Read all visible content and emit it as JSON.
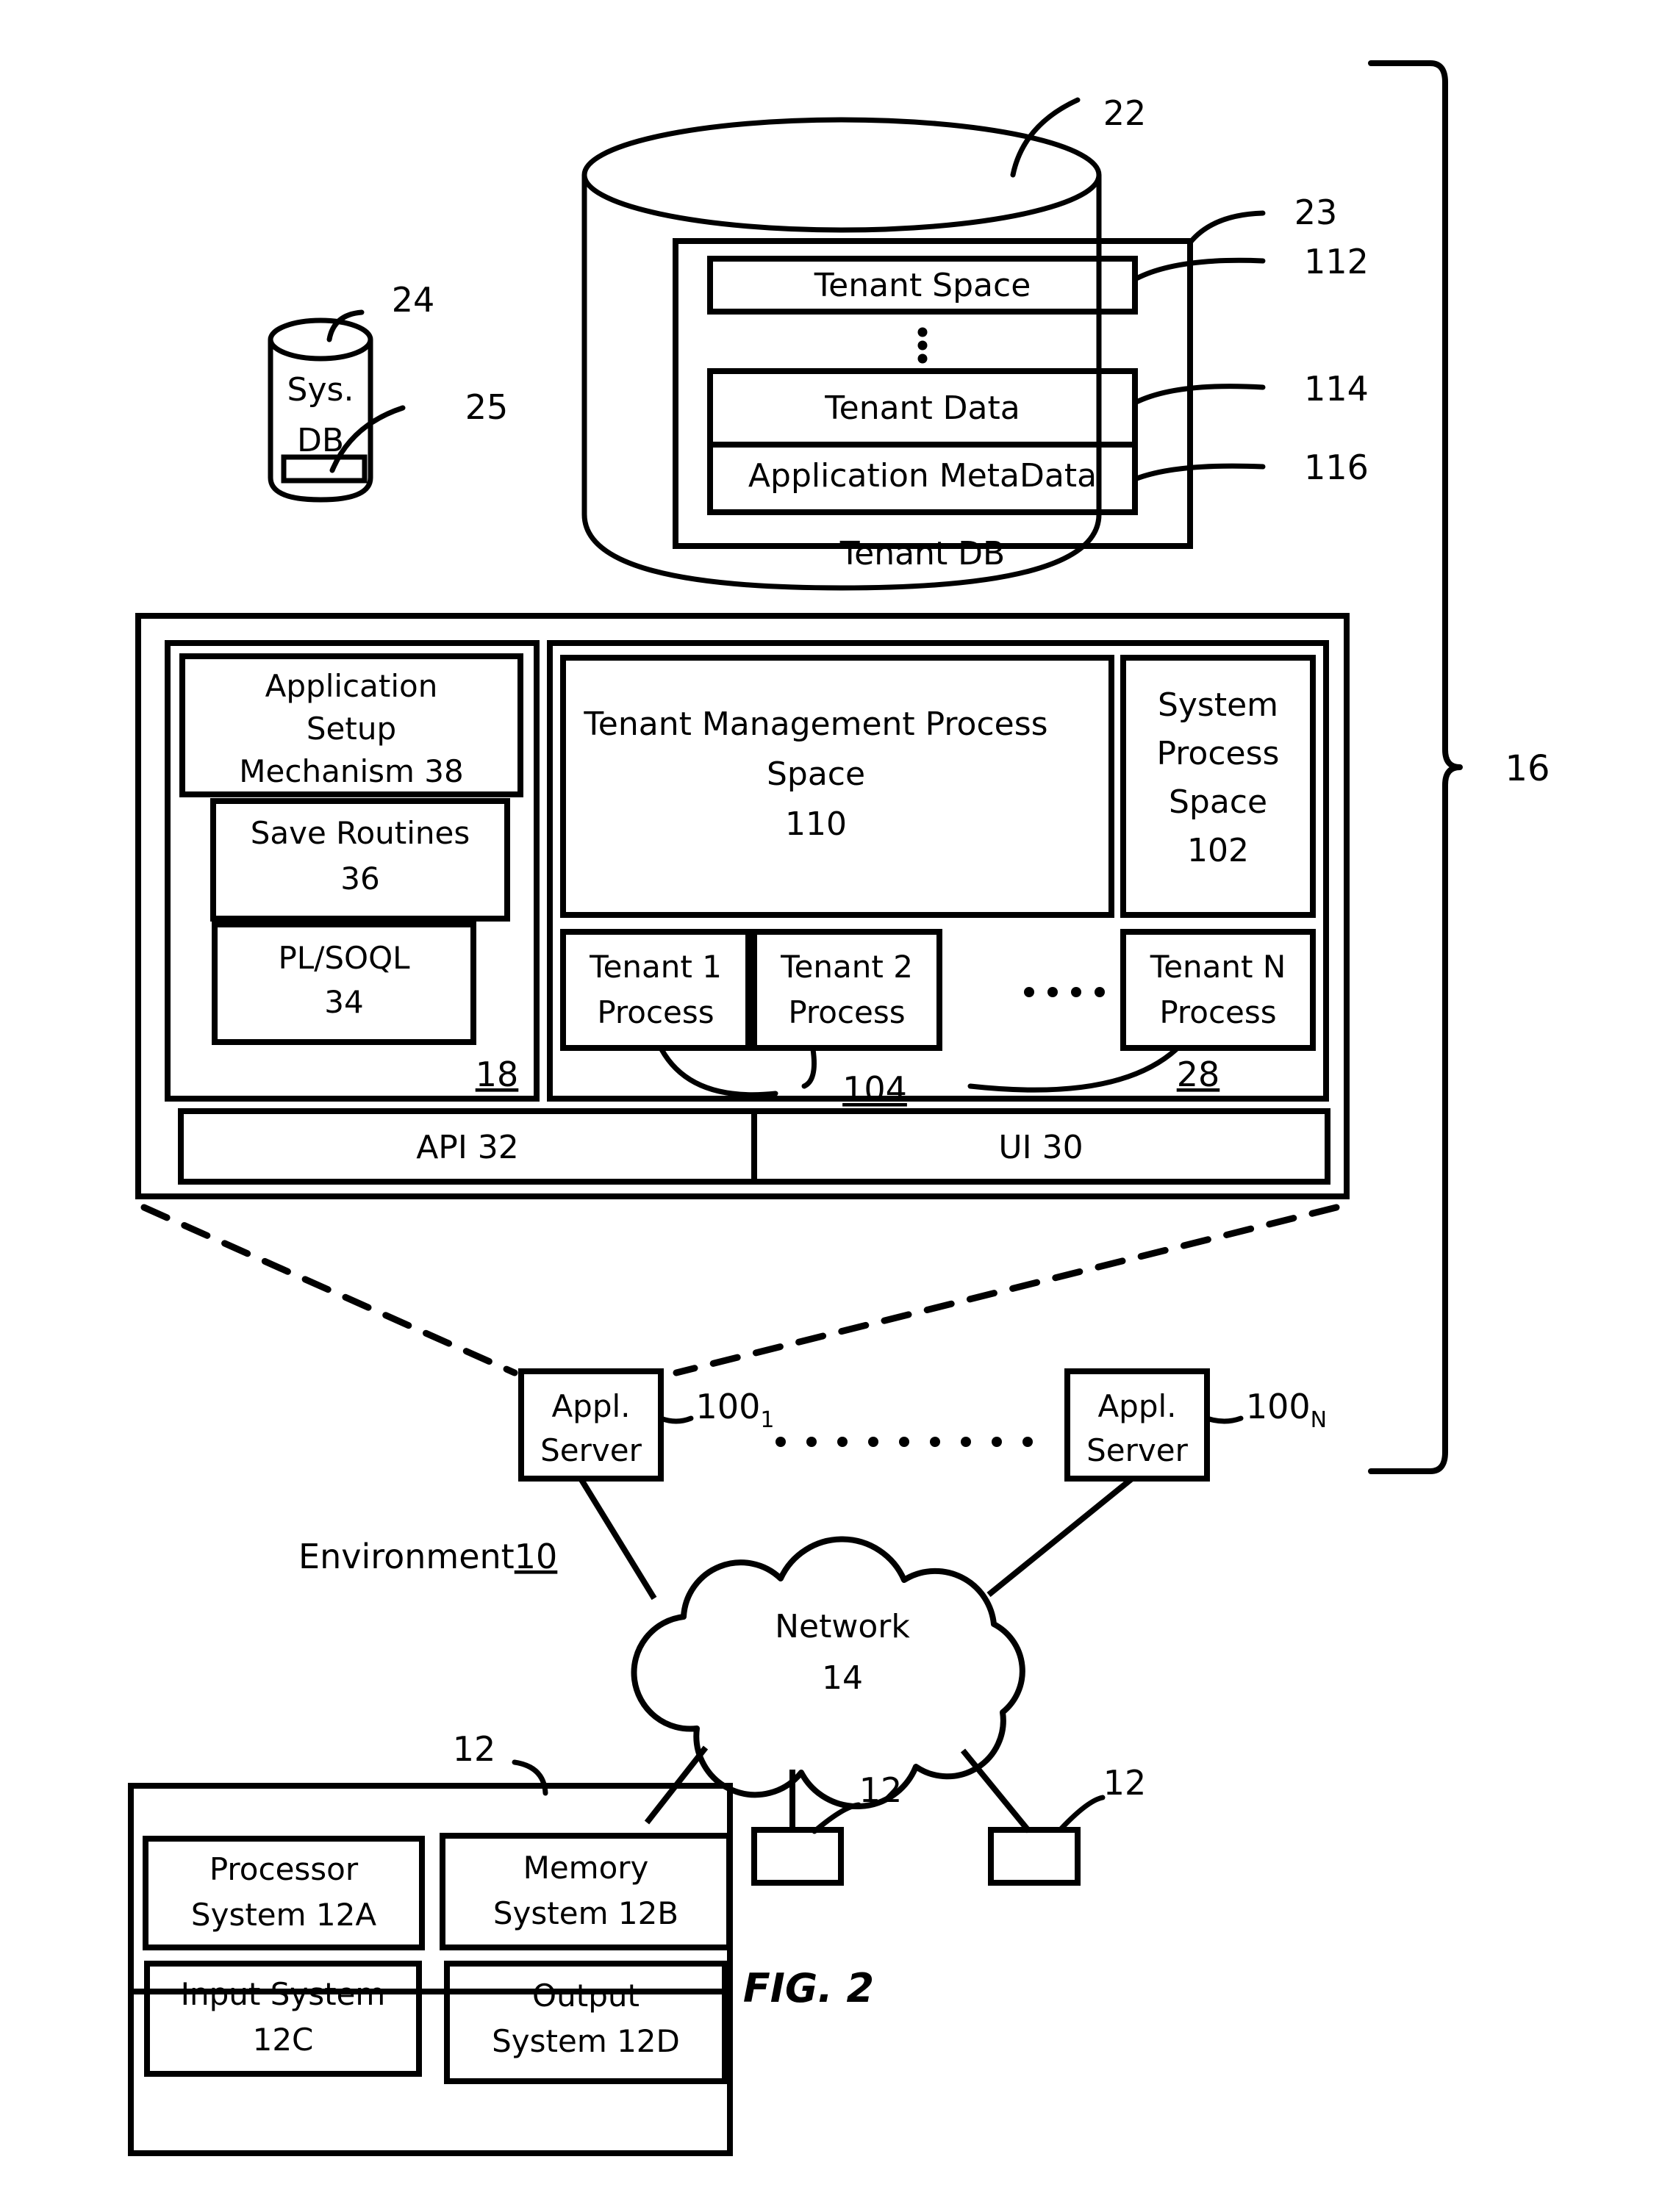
{
  "figure": {
    "caption": "FIG. 2",
    "domain_note": "patent-block-diagram"
  },
  "system_db": {
    "line1": "Sys.",
    "line2": "DB",
    "ref_cylinder": "24",
    "ref_inner": "25"
  },
  "tenant_db": {
    "caption": "Tenant DB",
    "ref_cylinder": "22",
    "ref_outer_box": "23",
    "blocks": [
      {
        "label": "Tenant Space",
        "ref": "112"
      },
      {
        "label": "Tenant Data",
        "ref": "114"
      },
      {
        "label": "Application MetaData",
        "ref": "116"
      }
    ],
    "ellipsis": "⋮"
  },
  "system": {
    "ref_bracket": "16",
    "app_platform": {
      "ref": "18",
      "blocks": [
        {
          "label": "Application Setup Mechanism 38",
          "lines": [
            "Application",
            "Setup",
            "Mechanism 38"
          ]
        },
        {
          "label": "Save Routines 36",
          "lines": [
            "Save Routines",
            "36"
          ]
        },
        {
          "label": "PL/SOQL 34",
          "lines": [
            "PL/SOQL",
            "34"
          ]
        }
      ]
    },
    "process_space": {
      "ref": "28",
      "ref_tenant_process": "104",
      "tenant_mgmt": {
        "lines": [
          "Tenant Management Process",
          "Space",
          "110"
        ],
        "ref": "110"
      },
      "system_process": {
        "lines": [
          "System",
          "Process",
          "Space",
          "102"
        ],
        "ref": "102"
      },
      "tenant_processes": [
        {
          "lines": [
            "Tenant 1",
            "Process"
          ]
        },
        {
          "lines": [
            "Tenant 2",
            "Process"
          ]
        },
        {
          "lines": [
            "Tenant N",
            "Process"
          ]
        }
      ],
      "process_ellipsis": "․ ․ ․ ․"
    },
    "bottom_bar": [
      {
        "label": "API 32"
      },
      {
        "label": "UI 30"
      }
    ]
  },
  "app_servers": [
    {
      "lines": [
        "Appl.",
        "Server"
      ],
      "ref_base": "100",
      "ref_sub": "1"
    },
    {
      "lines": [
        "Appl.",
        "Server"
      ],
      "ref_base": "100",
      "ref_sub": "N"
    }
  ],
  "app_server_ellipsis": ". . . . . . . . .",
  "environment": {
    "label": "Environment",
    "ref": "10"
  },
  "network": {
    "line1": "Network",
    "line2": "14"
  },
  "user_system": {
    "ref": "12",
    "blocks": [
      {
        "lines": [
          "Processor",
          "System 12A"
        ]
      },
      {
        "lines": [
          "Memory",
          "System 12B"
        ]
      },
      {
        "lines": [
          "Input System",
          "12C"
        ]
      },
      {
        "lines": [
          "Output",
          "System 12D"
        ]
      }
    ]
  },
  "user_devices": [
    {
      "ref": "12"
    },
    {
      "ref": "12"
    }
  ],
  "colors": {
    "ink": "#000000",
    "paper": "#ffffff"
  }
}
